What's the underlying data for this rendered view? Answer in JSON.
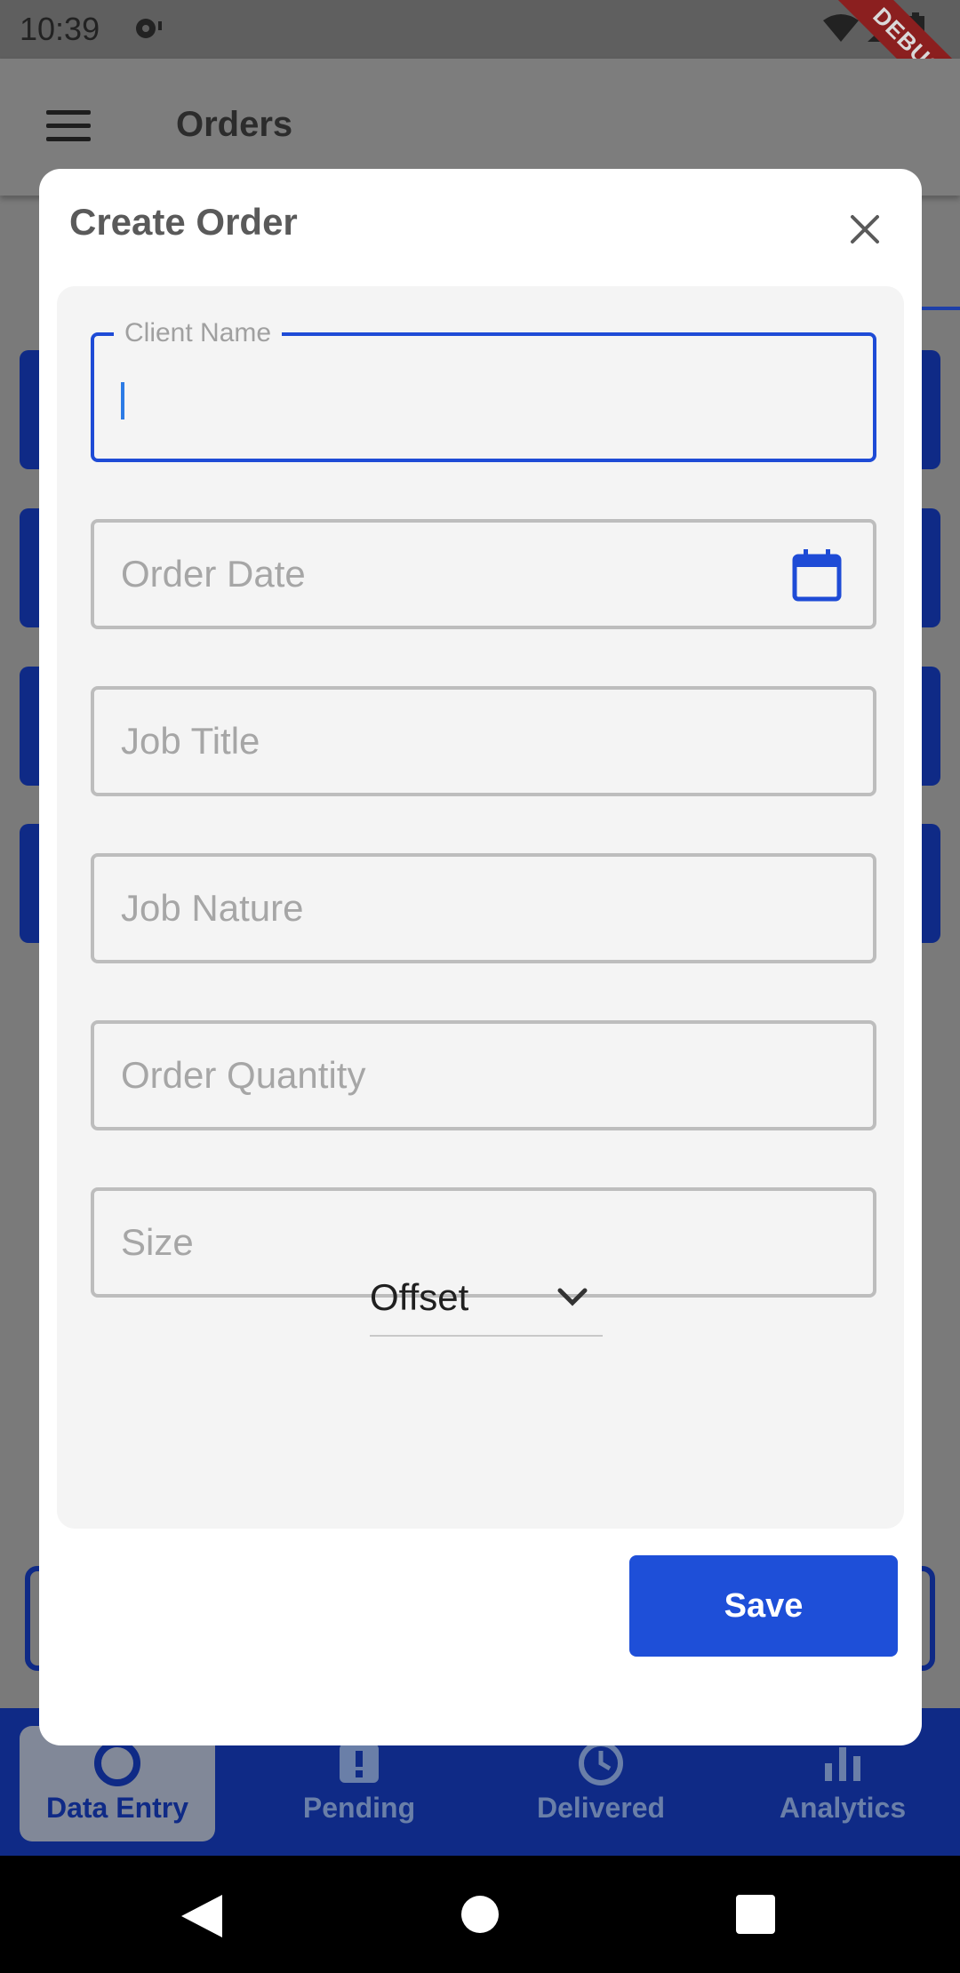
{
  "status_bar": {
    "time": "10:39",
    "debug_banner": "DEBUG"
  },
  "app_bar": {
    "title": "Orders"
  },
  "dialog": {
    "title": "Create Order",
    "fields": {
      "client_name_label": "Client Name",
      "order_date_placeholder": "Order Date",
      "job_title_placeholder": "Job Title",
      "job_nature_placeholder": "Job Nature",
      "order_quantity_placeholder": "Order Quantity",
      "size_placeholder": "Size"
    },
    "dropdown_value": "Offset",
    "save_label": "Save"
  },
  "bottom_nav": {
    "items": [
      {
        "label": "Data Entry",
        "active": true
      },
      {
        "label": "Pending"
      },
      {
        "label": "Delivered"
      },
      {
        "label": "Analytics"
      }
    ]
  },
  "colors": {
    "primary": "#1e4fd8",
    "nav_bg": "#0f2a86"
  },
  "icons": [
    "menu-icon",
    "close-icon",
    "calendar-icon",
    "chevron-down-icon",
    "data-entry-icon",
    "pending-icon",
    "delivered-icon",
    "analytics-icon"
  ]
}
